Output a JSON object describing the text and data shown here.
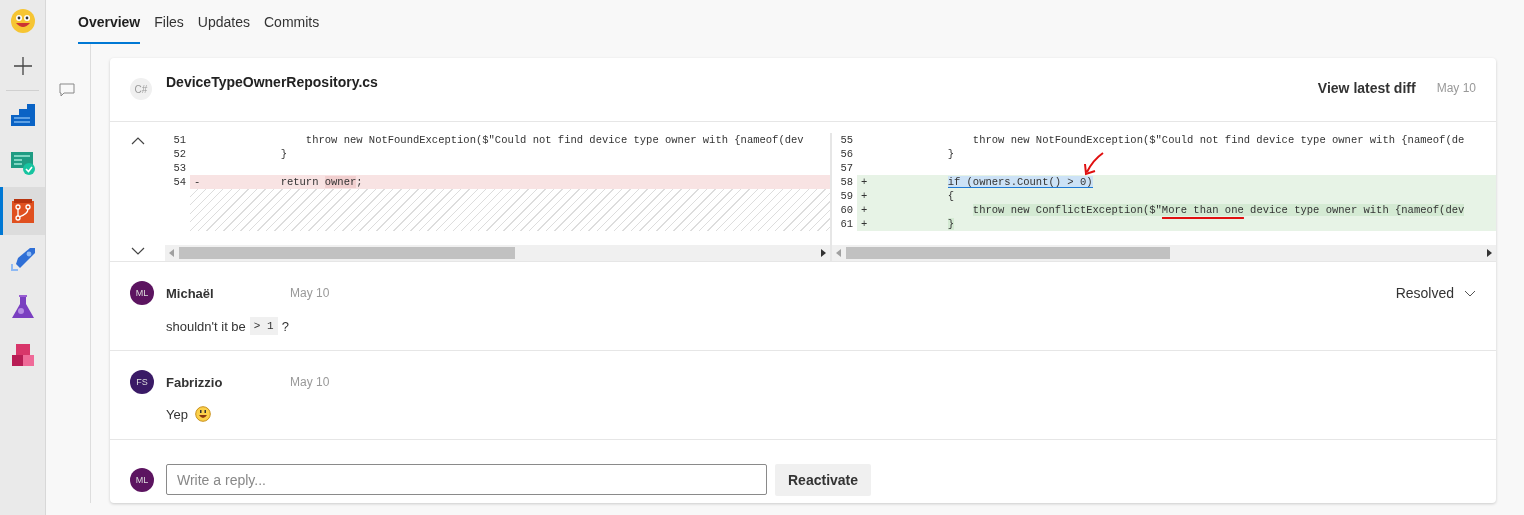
{
  "sidebar": {
    "items": [
      {
        "kind": "logo",
        "selected": false
      },
      {
        "kind": "add",
        "selected": false
      },
      {
        "kind": "boards",
        "selected": false
      },
      {
        "kind": "tests",
        "selected": false
      },
      {
        "kind": "repos",
        "selected": true
      },
      {
        "kind": "pipelines",
        "selected": false
      },
      {
        "kind": "lab",
        "selected": false
      },
      {
        "kind": "artifacts",
        "selected": false
      }
    ]
  },
  "tabs": [
    {
      "label": "Overview",
      "selected": true
    },
    {
      "label": "Files",
      "selected": false
    },
    {
      "label": "Updates",
      "selected": false
    },
    {
      "label": "Commits",
      "selected": false
    }
  ],
  "thread": {
    "file": {
      "badge": "C#",
      "name": "DeviceTypeOwnerRepository.cs",
      "action": "View latest diff",
      "date": "May 10"
    },
    "diff": {
      "panes": [
        {
          "blank_fill": true,
          "lines": [
            {
              "number": "51",
              "kind": "context",
              "segments": [
                {
                  "text": "                throw new NotFoundException($\"Could not find device type owner with {nameof(dev",
                  "kind": "plain"
                }
              ]
            },
            {
              "number": "52",
              "kind": "context",
              "segments": [
                {
                  "text": "            }",
                  "kind": "plain"
                }
              ]
            },
            {
              "number": "53",
              "kind": "context"
            },
            {
              "number": "54",
              "kind": "removed",
              "sign": "-",
              "segments": [
                {
                  "text": "            return ",
                  "kind": "plain"
                },
                {
                  "text": "owner",
                  "kind": "changed"
                },
                {
                  "text": ";",
                  "kind": "plain"
                }
              ]
            }
          ]
        },
        {
          "blank_fill": false,
          "lines": [
            {
              "number": "55",
              "kind": "context",
              "segments": [
                {
                  "text": "                throw new NotFoundException($\"Could not find device type owner with {nameof(de",
                  "kind": "plain"
                }
              ]
            },
            {
              "number": "56",
              "kind": "context",
              "segments": [
                {
                  "text": "            }",
                  "kind": "plain"
                }
              ]
            },
            {
              "number": "57",
              "kind": "context"
            },
            {
              "number": "58",
              "kind": "added",
              "sign": "+",
              "segments": [
                {
                  "text": "            if (owners.Count() > 0)",
                  "kind": "selection"
                }
              ]
            },
            {
              "number": "59",
              "kind": "added",
              "sign": "+",
              "segments": [
                {
                  "text": "            {",
                  "kind": "plain"
                }
              ]
            },
            {
              "number": "60",
              "kind": "added",
              "sign": "+",
              "segments": [
                {
                  "text": "                throw new ConflictException($\"",
                  "kind": "changed"
                },
                {
                  "text": "More than one",
                  "kind": "underlined"
                },
                {
                  "text": " device type owner with {nameof(dev",
                  "kind": "changed"
                }
              ]
            },
            {
              "number": "61",
              "kind": "added",
              "sign": "+",
              "segments": [
                {
                  "text": "            }",
                  "kind": "changed"
                }
              ]
            }
          ]
        }
      ]
    },
    "comments": [
      {
        "initials": "ML",
        "color": "#5c1460",
        "author": "Michaël",
        "date": "May 10",
        "status": "Resolved",
        "body": [
          {
            "text": "shouldn't it be",
            "code": false
          },
          {
            "text": "> 1",
            "code": true
          },
          {
            "text": "?",
            "code": false
          }
        ],
        "emoji": false
      },
      {
        "initials": "FS",
        "color": "#3a1a66",
        "author": "Fabrizzio",
        "date": "May 10",
        "body": [
          {
            "text": "Yep",
            "code": false
          }
        ],
        "emoji": true
      }
    ],
    "reply": {
      "initials": "ML",
      "color": "#5c1460",
      "placeholder": "Write a reply...",
      "button": "Reactivate"
    }
  }
}
